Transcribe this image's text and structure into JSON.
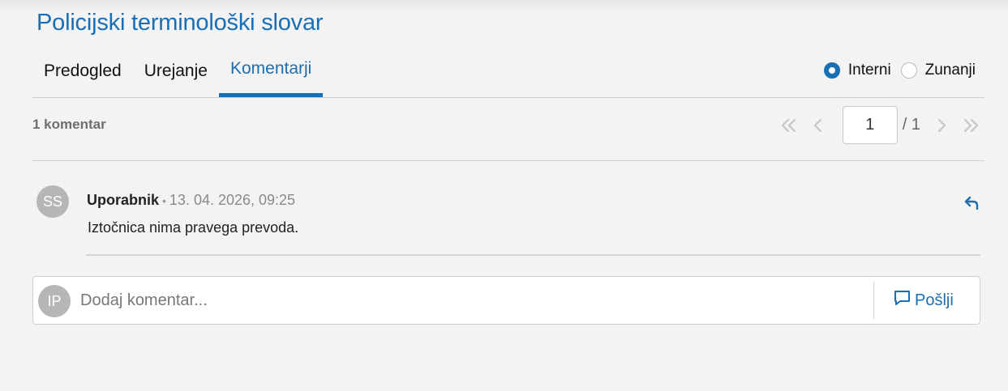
{
  "app": {
    "title": "Policijski terminološki slovar"
  },
  "tabs": [
    {
      "label": "Predogled"
    },
    {
      "label": "Urejanje"
    },
    {
      "label": "Komentarji",
      "active": true
    }
  ],
  "visibility": {
    "options": [
      {
        "label": "Interni",
        "selected": true
      },
      {
        "label": "Zunanji",
        "selected": false
      }
    ]
  },
  "comments_summary": {
    "count_label": "1 komentar"
  },
  "pager": {
    "current_page": "1",
    "total_label": "/ 1"
  },
  "comments": [
    {
      "avatar_initials": "SS",
      "author": "Uporabnik",
      "separator": "•",
      "timestamp": "13. 04. 2026, 09:25",
      "text": "Iztočnica nima pravega prevoda."
    }
  ],
  "composer": {
    "avatar_initials": "IP",
    "placeholder": "Dodaj komentar...",
    "send_label": "Pošlji"
  },
  "colors": {
    "accent": "#1a6fb4",
    "avatar_bg": "#b5b6b8",
    "background": "#f3f3f3"
  },
  "icons": {
    "pager": [
      "first-page-icon",
      "prev-page-icon",
      "next-page-icon",
      "last-page-icon"
    ],
    "reply": "reply-icon",
    "send": "comment-icon"
  }
}
